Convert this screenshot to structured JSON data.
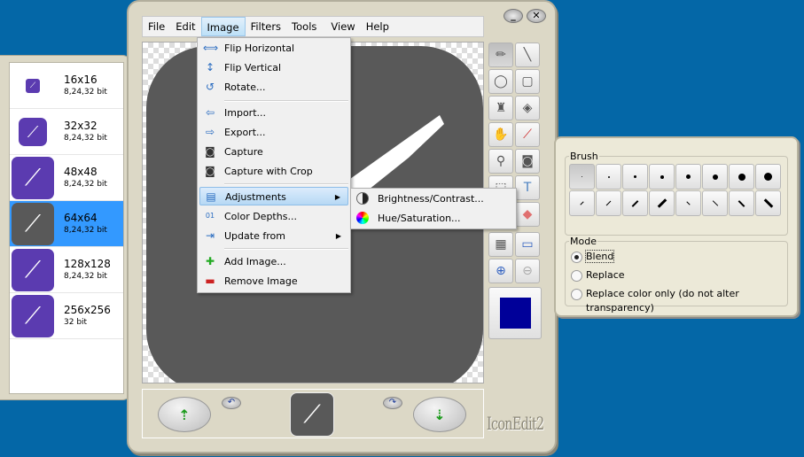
{
  "menubar": {
    "items": [
      "File",
      "Edit",
      "Image",
      "Filters",
      "Tools",
      "View",
      "Help"
    ],
    "open": "Image"
  },
  "image_menu": {
    "items": [
      {
        "label": "Flip Horizontal",
        "icon": "flip-horizontal-icon"
      },
      {
        "label": "Flip Vertical",
        "icon": "flip-vertical-icon"
      },
      {
        "label": "Rotate...",
        "icon": "rotate-icon"
      },
      {
        "label": "Import...",
        "icon": "import-icon"
      },
      {
        "label": "Export...",
        "icon": "export-icon"
      },
      {
        "label": "Capture",
        "icon": "camera-icon"
      },
      {
        "label": "Capture with Crop",
        "icon": "camera-crop-icon"
      },
      {
        "label": "Adjustments",
        "icon": "adjustments-icon",
        "submenu": true,
        "highlighted": true
      },
      {
        "label": "Color Depths...",
        "icon": "color-depth-icon"
      },
      {
        "label": "Update from",
        "icon": "update-icon",
        "submenu": true
      },
      {
        "label": "Add Image...",
        "icon": "add-image-icon"
      },
      {
        "label": "Remove Image",
        "icon": "remove-image-icon"
      }
    ]
  },
  "adjustments_submenu": {
    "items": [
      "Brightness/Contrast...",
      "Hue/Saturation..."
    ]
  },
  "image_list": [
    {
      "size": "16x16",
      "depth": "8,24,32 bit"
    },
    {
      "size": "32x32",
      "depth": "8,24,32 bit"
    },
    {
      "size": "48x48",
      "depth": "8,24,32 bit"
    },
    {
      "size": "64x64",
      "depth": "8,24,32 bit",
      "selected": true
    },
    {
      "size": "128x128",
      "depth": "8,24,32 bit"
    },
    {
      "size": "256x256",
      "depth": "32 bit"
    }
  ],
  "tools": [
    "pencil",
    "line",
    "ellipse",
    "rounded-rectangle",
    "spray",
    "fill-bucket",
    "hand",
    "color-picker",
    "magnifier",
    "camera",
    "selection",
    "text",
    "eraser-alt",
    "eraser",
    "grid",
    "fit",
    "zoom-in",
    "zoom-out"
  ],
  "active_tool": "pencil",
  "current_color": "#000099",
  "icon_color": "#5b3bb0",
  "brush_panel": {
    "brush_title": "Brush",
    "mode_title": "Mode",
    "modes": [
      "Blend",
      "Replace",
      "Replace color only (do not alter transparency)"
    ],
    "selected_mode": "Blend"
  },
  "window": {
    "minimize": "_",
    "close": "✕"
  },
  "logo": "IconEdit2"
}
